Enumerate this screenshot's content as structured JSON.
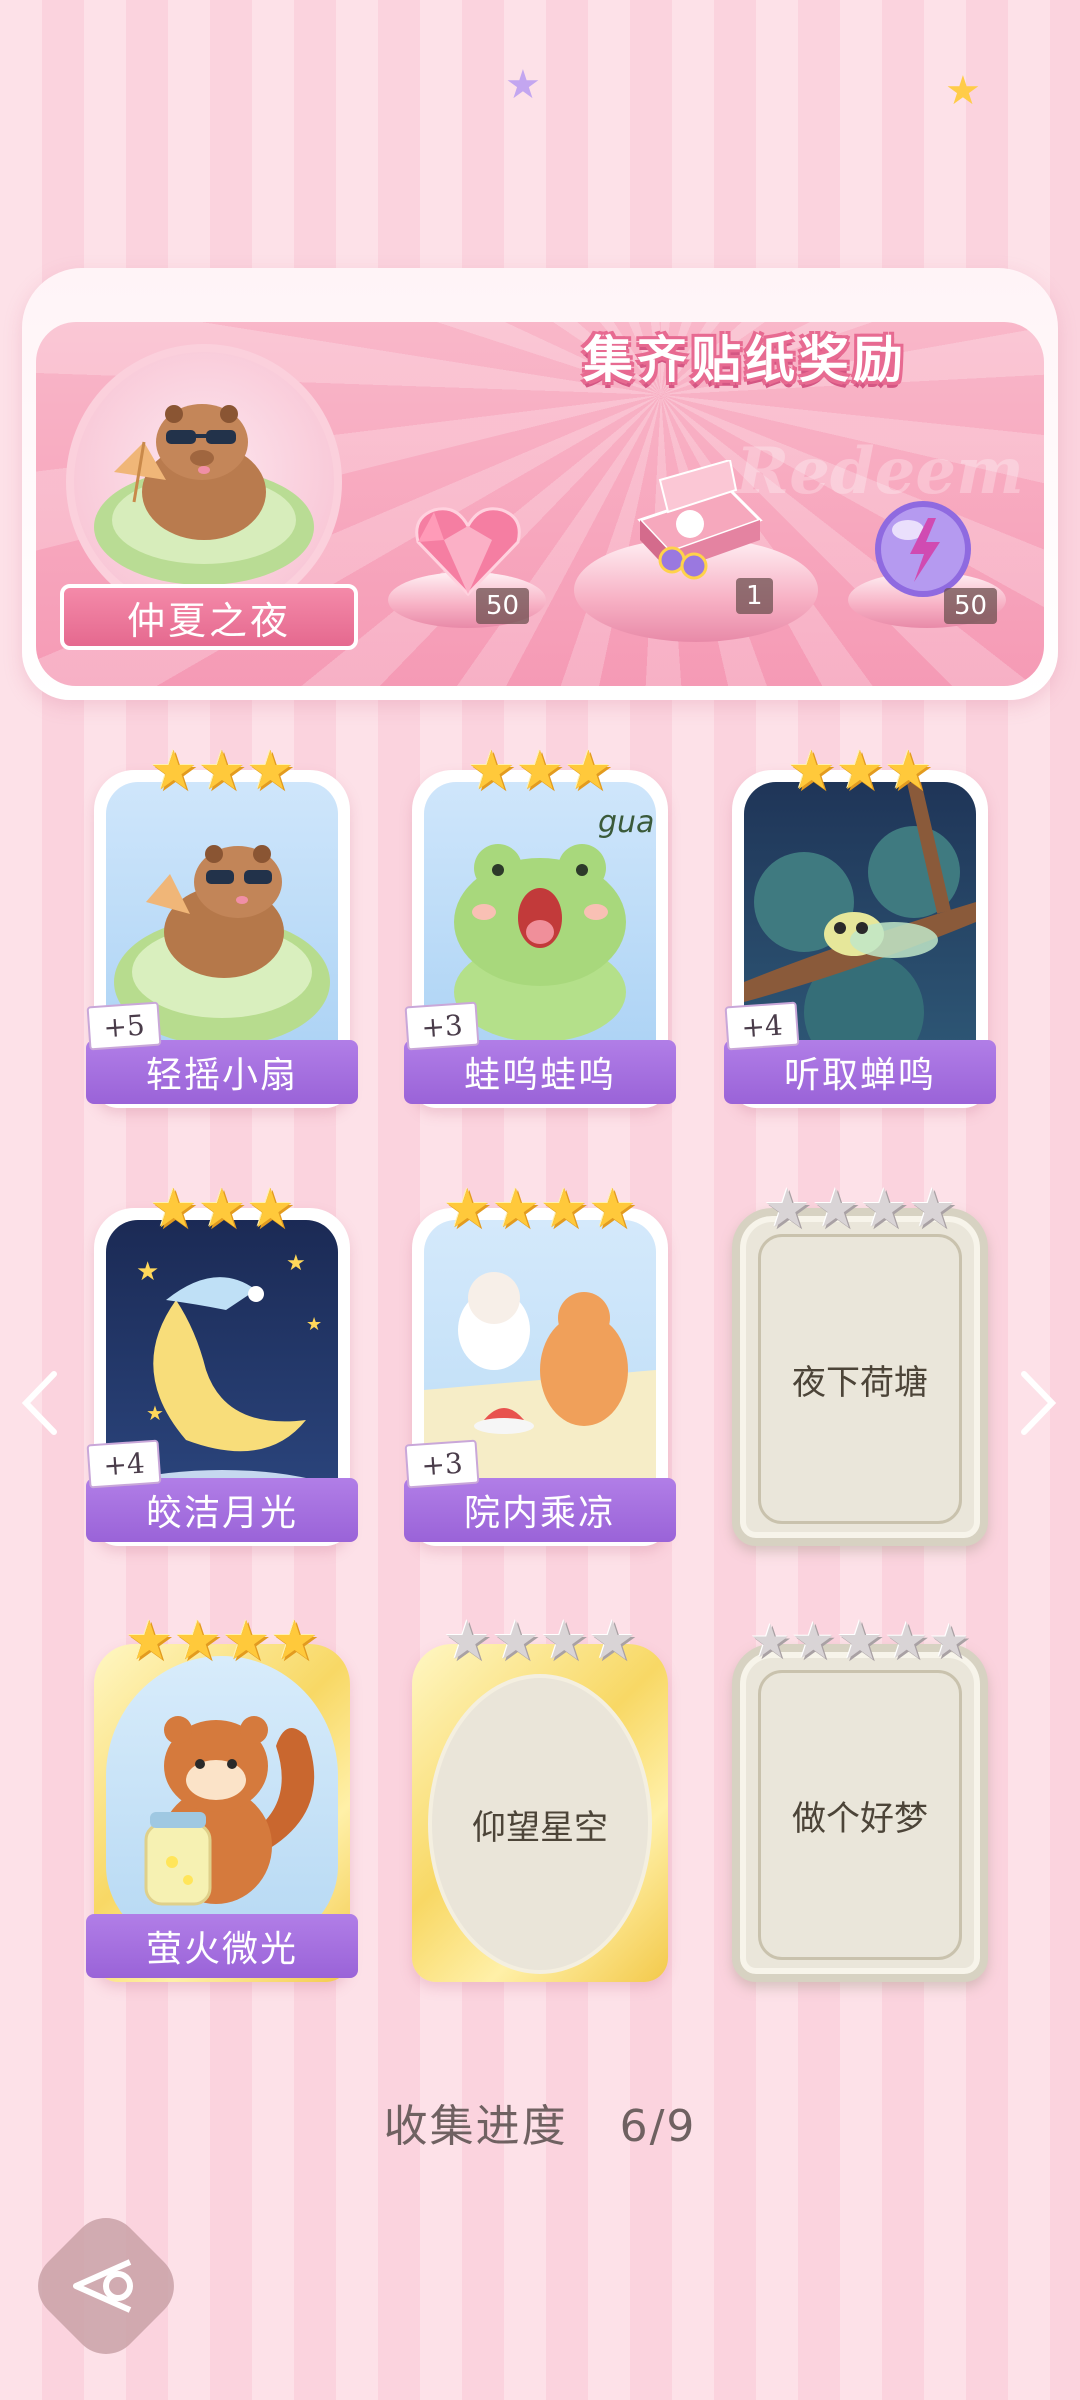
{
  "banner": {
    "title": "集齐贴纸奖励",
    "watermark": "Redeem",
    "set_name": "仲夏之夜",
    "rewards": [
      {
        "icon": "pink-heart-gem-icon",
        "count": "50"
      },
      {
        "icon": "gift-box-icon",
        "count": "1"
      },
      {
        "icon": "lightning-orb-icon",
        "count": "50"
      }
    ]
  },
  "stickers": [
    {
      "name": "轻摇小扇",
      "bonus": "+5",
      "stars": 3,
      "max_stars": 3,
      "collected": true
    },
    {
      "name": "蛙呜蛙呜",
      "bonus": "+3",
      "stars": 3,
      "max_stars": 3,
      "collected": true
    },
    {
      "name": "听取蝉鸣",
      "bonus": "+4",
      "stars": 3,
      "max_stars": 3,
      "collected": true
    },
    {
      "name": "皎洁月光",
      "bonus": "+4",
      "stars": 3,
      "max_stars": 3,
      "collected": true
    },
    {
      "name": "院内乘凉",
      "bonus": "+3",
      "stars": 4,
      "max_stars": 4,
      "collected": true
    },
    {
      "name": "夜下荷塘",
      "bonus": "",
      "stars": 0,
      "max_stars": 4,
      "collected": false
    },
    {
      "name": "萤火微光",
      "bonus": "",
      "stars": 4,
      "max_stars": 4,
      "collected": true
    },
    {
      "name": "仰望星空",
      "bonus": "",
      "stars": 0,
      "max_stars": 4,
      "collected": false
    },
    {
      "name": "做个好梦",
      "bonus": "",
      "stars": 0,
      "max_stars": 5,
      "collected": false
    }
  ],
  "frog_text": "gua",
  "progress": {
    "label": "收集进度",
    "value": "6/9"
  },
  "colors": {
    "accent_purple": "#9a63d8",
    "pink": "#f7a6bd",
    "gold": "#ffc93b"
  }
}
